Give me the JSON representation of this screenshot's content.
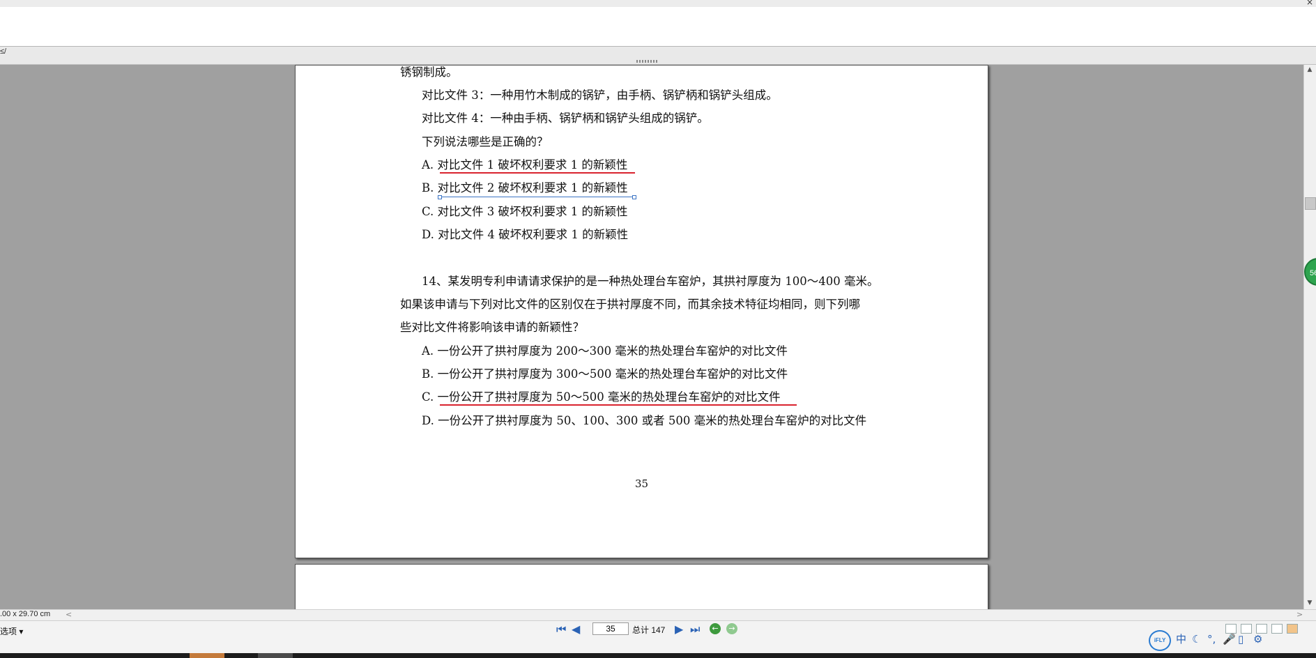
{
  "tab_fragment": "≤/",
  "window": {
    "close_icon": "×"
  },
  "document": {
    "page35": {
      "lines": [
        "锈钢制成。",
        "对比文件 3：一种用竹木制成的锅铲，由手柄、锅铲柄和锅铲头组成。",
        "对比文件 4：一种由手柄、锅铲柄和锅铲头组成的锅铲。",
        "下列说法哪些是正确的？",
        "A. 对比文件 1 破坏权利要求 1 的新颖性",
        "B. 对比文件 2 破坏权利要求 1 的新颖性",
        "C. 对比文件 3 破坏权利要求 1 的新颖性",
        "D. 对比文件 4 破坏权利要求 1 的新颖性",
        "14、某发明专利申请请求保护的是一种热处理台车窑炉，其拱衬厚度为 100～400 毫米。",
        "如果该申请与下列对比文件的区别仅在于拱衬厚度不同，而其余技术特征均相同，则下列哪",
        "些对比文件将影响该申请的新颖性？",
        "A. 一份公开了拱衬厚度为 200～300 毫米的热处理台车窑炉的对比文件",
        "B. 一份公开了拱衬厚度为 300～500 毫米的热处理台车窑炉的对比文件",
        "C. 一份公开了拱衬厚度为 50～500 毫米的热处理台车窑炉的对比文件",
        "D. 一份公开了拱衬厚度为 50、100、300 或者 500 毫米的热处理台车窑炉的对比文件"
      ],
      "page_number": "35"
    }
  },
  "badge": {
    "label": "56"
  },
  "status": {
    "page_size": ".00 x 29.70 cm",
    "options_label": "选项 ▾",
    "current_page": "35",
    "total_label": "总计 147"
  },
  "icons": {
    "first": "⏮",
    "prev": "◀",
    "next": "▶",
    "last": "⏭",
    "back": "←",
    "forward": "→",
    "scroll_up": "▲",
    "scroll_down": "▼",
    "scroll_left": "<",
    "scroll_right": ">"
  },
  "ime": {
    "logo": "iFLY",
    "lang": "中",
    "moon": "☾",
    "punct": "°,",
    "mic": "🎤",
    "doc": "▯",
    "gear": "⚙"
  },
  "colors": {
    "underline": "#d9232e",
    "selection": "#3c74c4",
    "accent": "#2a62b5"
  }
}
